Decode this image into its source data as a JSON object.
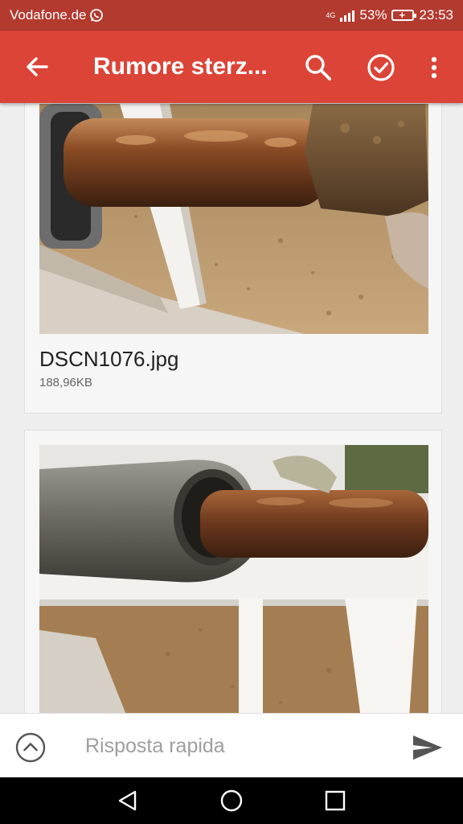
{
  "status_bar": {
    "carrier": "Vodafone.de",
    "network": "4G",
    "battery": "53%",
    "time": "23:53"
  },
  "app_bar": {
    "title": "Rumore sterz..."
  },
  "attachments": [
    {
      "filename": "DSCN1076.jpg",
      "size": "188,96KB"
    },
    {
      "filename": "",
      "size": ""
    }
  ],
  "reply": {
    "placeholder": "Risposta rapida"
  },
  "colors": {
    "app_bar": "#db4437",
    "status_bar": "#b23a2f",
    "background": "#eeeeee"
  },
  "icons": [
    "whatsapp-icon",
    "signal-icon",
    "battery-icon",
    "back-arrow-icon",
    "search-icon",
    "check-circle-icon",
    "more-vert-icon",
    "expand-up-icon",
    "send-icon",
    "nav-back-icon",
    "nav-home-icon",
    "nav-recents-icon"
  ]
}
